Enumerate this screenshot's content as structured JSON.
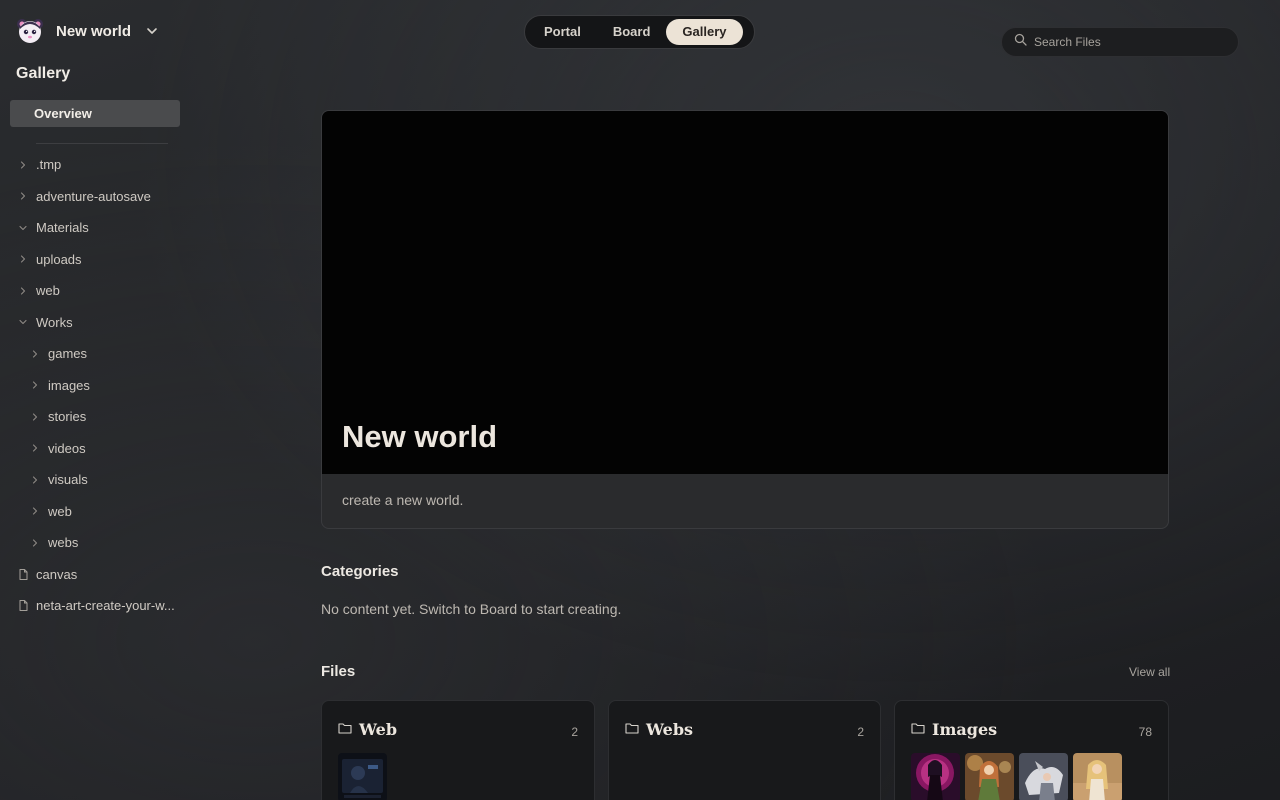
{
  "workspace": {
    "name": "New world"
  },
  "sidebar": {
    "title": "Gallery",
    "overview_label": "Overview",
    "tree": [
      {
        "label": ".tmp",
        "kind": "folder",
        "state": "collapsed",
        "level": 0
      },
      {
        "label": "adventure-autosave",
        "kind": "folder",
        "state": "collapsed",
        "level": 0
      },
      {
        "label": "Materials",
        "kind": "folder",
        "state": "expanded",
        "level": 0
      },
      {
        "label": "uploads",
        "kind": "folder",
        "state": "collapsed",
        "level": 0
      },
      {
        "label": "web",
        "kind": "folder",
        "state": "collapsed",
        "level": 0
      },
      {
        "label": "Works",
        "kind": "folder",
        "state": "expanded",
        "level": 0
      },
      {
        "label": "games",
        "kind": "folder",
        "state": "collapsed",
        "level": 1
      },
      {
        "label": "images",
        "kind": "folder",
        "state": "collapsed",
        "level": 1
      },
      {
        "label": "stories",
        "kind": "folder",
        "state": "collapsed",
        "level": 1
      },
      {
        "label": "videos",
        "kind": "folder",
        "state": "collapsed",
        "level": 1
      },
      {
        "label": "visuals",
        "kind": "folder",
        "state": "collapsed",
        "level": 1
      },
      {
        "label": "web",
        "kind": "folder",
        "state": "collapsed",
        "level": 1
      },
      {
        "label": "webs",
        "kind": "folder",
        "state": "collapsed",
        "level": 1
      },
      {
        "label": "canvas",
        "kind": "file",
        "level": 0
      },
      {
        "label": "neta-art-create-your-w...",
        "kind": "file",
        "level": 0
      }
    ]
  },
  "modes": {
    "tabs": [
      {
        "label": "Portal",
        "active": false
      },
      {
        "label": "Board",
        "active": false
      },
      {
        "label": "Gallery",
        "active": true
      }
    ]
  },
  "search": {
    "placeholder": "Search Files",
    "value": ""
  },
  "hero": {
    "title": "New world",
    "description": "create a new world."
  },
  "categories": {
    "title": "Categories",
    "empty_text": "No content yet. Switch to Board to start creating."
  },
  "files": {
    "title": "Files",
    "view_all": "View all",
    "cards": [
      {
        "name": "Web",
        "count": "2",
        "thumbnails": [
          "web-preview-dark"
        ]
      },
      {
        "name": "Webs",
        "count": "2",
        "thumbnails": []
      },
      {
        "name": "Images",
        "count": "78",
        "thumbnails": [
          "anime-pink-girl",
          "fantasy-elf-girl",
          "white-wolf-warrior",
          "blonde-girl-desert"
        ]
      }
    ]
  },
  "colors": {
    "background": "#252629",
    "active_tab": "#ece3d6",
    "overview_bg": "#4a4b4d",
    "hero_cover": "#030303"
  },
  "icons": {
    "logo": "bear-mascot-logo",
    "workspace_switch": "chevron-down-icon",
    "search": "search-icon",
    "tree_collapsed": "chevron-right-icon",
    "tree_expanded": "chevron-down-icon",
    "file": "file-icon",
    "folder": "folder-icon"
  }
}
